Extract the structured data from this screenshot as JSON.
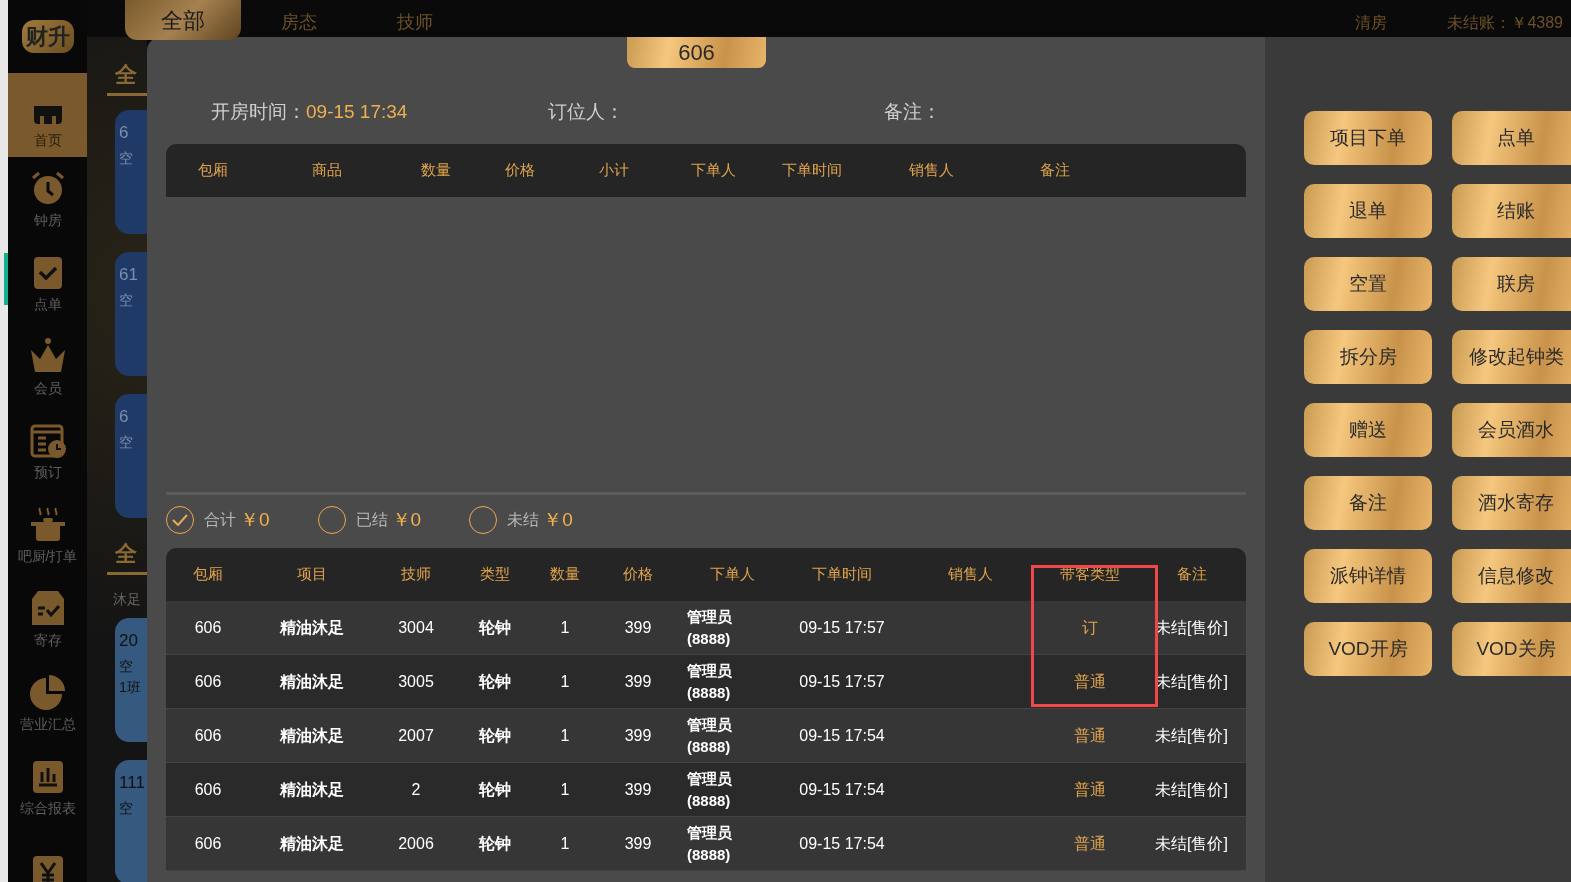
{
  "sidebar": {
    "logo": "财升",
    "items": [
      {
        "label": "首页",
        "selected": true
      },
      {
        "label": "钟房",
        "selected": false
      },
      {
        "label": "点单",
        "selected": false
      },
      {
        "label": "会员",
        "selected": false
      },
      {
        "label": "预订",
        "selected": false
      },
      {
        "label": "吧厨/打单",
        "selected": false
      },
      {
        "label": "寄存",
        "selected": false
      },
      {
        "label": "营业汇总",
        "selected": false
      },
      {
        "label": "综合报表",
        "selected": false
      },
      {
        "selected": false
      }
    ]
  },
  "top_tabs": [
    {
      "label": "全部",
      "selected": true
    },
    {
      "label": "房态",
      "selected": false
    },
    {
      "label": "技师",
      "selected": false
    }
  ],
  "top_right": {
    "clean": "清房",
    "unpaid": "未结账：￥4389"
  },
  "background": {
    "sections": [
      {
        "title": "全",
        "cards": [
          {
            "number": "6",
            "status": "空"
          },
          {
            "number": "61",
            "status": "空"
          },
          {
            "number": "6",
            "status": "空"
          }
        ]
      },
      {
        "title": "全",
        "subtitle": "沐足",
        "cards": [
          {
            "number": "20",
            "status": "空",
            "shift": "1班"
          },
          {
            "number": "111",
            "status": "空"
          }
        ]
      }
    ]
  },
  "dialog": {
    "room_tab": "606",
    "info": [
      {
        "label": "开房时间：",
        "value": "09-15 17:34"
      },
      {
        "label": "订位人："
      },
      {
        "label": "备注："
      }
    ],
    "goods_table": {
      "columns": [
        "包厢",
        "商品",
        "数量",
        "价格",
        "小计",
        "下单人",
        "下单时间",
        "销售人",
        "备注"
      ]
    },
    "totals": [
      {
        "label": "合计",
        "amount": "￥0",
        "selected": true
      },
      {
        "label": "已结",
        "amount": "￥0",
        "selected": false
      },
      {
        "label": "未结",
        "amount": "￥0",
        "selected": false
      }
    ],
    "items_table": {
      "columns": [
        "包厢",
        "项目",
        "技师",
        "类型",
        "数量",
        "价格",
        "下单人",
        "下单时间",
        "销售人",
        "带客类型",
        "备注"
      ],
      "rows": [
        [
          "606",
          "精油沐足",
          "3004",
          "轮钟",
          "1",
          "399",
          "管理员 (8888)",
          "09-15 17:57",
          "",
          "订",
          "未结[售价]"
        ],
        [
          "606",
          "精油沐足",
          "3005",
          "轮钟",
          "1",
          "399",
          "管理员 (8888)",
          "09-15 17:57",
          "",
          "普通",
          "未结[售价]"
        ],
        [
          "606",
          "精油沐足",
          "2007",
          "轮钟",
          "1",
          "399",
          "管理员 (8888)",
          "09-15 17:54",
          "",
          "普通",
          "未结[售价]"
        ],
        [
          "606",
          "精油沐足",
          "2",
          "轮钟",
          "1",
          "399",
          "管理员 (8888)",
          "09-15 17:54",
          "",
          "普通",
          "未结[售价]"
        ],
        [
          "606",
          "精油沐足",
          "2006",
          "轮钟",
          "1",
          "399",
          "管理员 (8888)",
          "09-15 17:54",
          "",
          "普通",
          "未结[售价]"
        ]
      ]
    },
    "actions": [
      [
        "项目下单",
        "点单"
      ],
      [
        "退单",
        "结账"
      ],
      [
        "空置",
        "联房"
      ],
      [
        "拆分房",
        "修改起钟类"
      ],
      [
        "赠送",
        "会员酒水"
      ],
      [
        "备注",
        "酒水寄存"
      ],
      [
        "派钟详情",
        "信息修改"
      ],
      [
        "VOD开房",
        "VOD关房"
      ]
    ]
  }
}
